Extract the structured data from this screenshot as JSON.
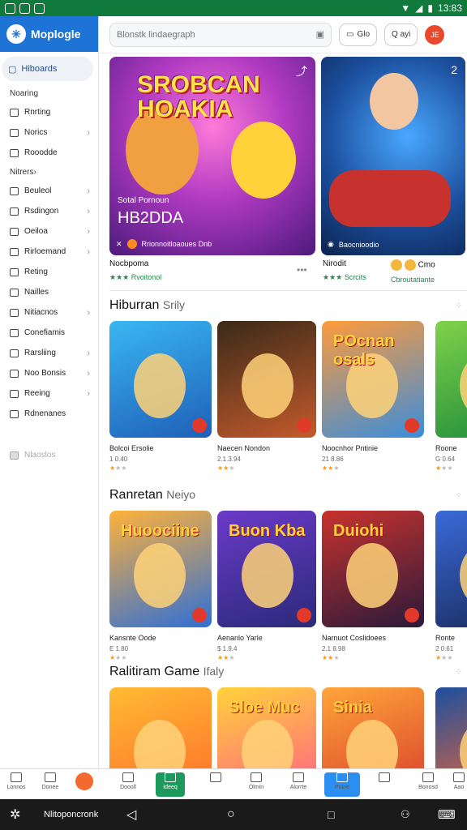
{
  "status_bar": {
    "time": "13:83"
  },
  "sidebar": {
    "brand": "Moplogle",
    "active_item": "Hiboards",
    "section_header": "Noaring",
    "items": [
      {
        "label": "Rnrting",
        "chev": false
      },
      {
        "label": "Norics",
        "chev": true
      },
      {
        "label": "Rooodde",
        "chev": false
      },
      {
        "label": "Nitrers",
        "chev": true,
        "header": true
      },
      {
        "label": "Beuleol",
        "chev": true
      },
      {
        "label": "Rsdingon",
        "chev": true
      },
      {
        "label": "Oeiloa",
        "chev": true
      },
      {
        "label": "Rirloemand",
        "chev": true
      },
      {
        "label": "Reting",
        "chev": false
      },
      {
        "label": "Nailles",
        "chev": false
      },
      {
        "label": "Nitiacnos",
        "chev": true
      },
      {
        "label": "Conefiamis",
        "chev": false
      },
      {
        "label": "Rarsliing",
        "chev": true
      },
      {
        "label": "Noo Bonsis",
        "chev": true
      },
      {
        "label": "Reeing",
        "chev": true
      },
      {
        "label": "Rdnenanes",
        "chev": false
      }
    ],
    "muted_item": "Nlaoslos"
  },
  "topbar": {
    "search_placeholder": "Blonstk lindaegraph",
    "btn1": "Glo",
    "btn2": "Q ayi",
    "avatar": "JE"
  },
  "hero": [
    {
      "title_line1": "SROBCAN",
      "title_line2": "HOAKIA",
      "subtitle": "Sotal Pornoun",
      "big": "HB2DDA",
      "footer": "Rrionnoitloaoues  Dnb",
      "name": "Nocbpoma",
      "rating": "★★★ Rvoitonol"
    },
    {
      "footer": "Baocnioodio",
      "name": "Nirodit",
      "side_text": "Cmo",
      "rating": "★★★ Scrcits",
      "side_rating": "Cbroutatiante",
      "badge": "2"
    }
  ],
  "sections": [
    {
      "title": "Hiburran",
      "title_thin": "Srily",
      "cards": [
        {
          "name": "Bolcoi Ersolie",
          "num": "1 0.40",
          "stars": 1,
          "thumb_title": ""
        },
        {
          "name": "Naecen Nondon",
          "num": "2.1.3.94",
          "stars": 2,
          "thumb_title": ""
        },
        {
          "name": "Noocnhor Pntinie",
          "num": "21 8.86",
          "stars": 2,
          "thumb_title": "POcnan osals"
        },
        {
          "name": "Roone",
          "num": "G 0.64",
          "stars": 1,
          "thumb_title": ""
        }
      ]
    },
    {
      "title": "Ranretan",
      "title_thin": "Neiyo",
      "cards": [
        {
          "name": "Kansnte Oode",
          "num": "E 1.80",
          "stars": 1,
          "thumb_title": "Huoociine"
        },
        {
          "name": "Aenanlo Yarle",
          "num": "$ 1.9.4",
          "stars": 2,
          "thumb_title": "Buon Kba"
        },
        {
          "name": "Narnuot Coslidoees",
          "num": "2.1 8.98",
          "stars": 2,
          "thumb_title": "Duiohi"
        },
        {
          "name": "Ronte",
          "num": "2 0.61",
          "stars": 1,
          "thumb_title": ""
        }
      ]
    },
    {
      "title": "Ralitiram Game",
      "title_thin": "Ifaly",
      "cards": [
        {
          "name": "",
          "num": "",
          "stars": 0,
          "thumb_title": ""
        },
        {
          "name": "",
          "num": "",
          "stars": 0,
          "thumb_title": "Sloe Muc"
        },
        {
          "name": "",
          "num": "",
          "stars": 0,
          "thumb_title": "Sinia"
        },
        {
          "name": "",
          "num": "",
          "stars": 0,
          "thumb_title": ""
        }
      ]
    }
  ],
  "bottom_nav": [
    "Lonnos",
    "Donee",
    "",
    "Doooll",
    "Ideeq",
    "",
    "Olmin",
    "Alorrte",
    "Poine",
    "",
    "Bonosd",
    "Aao"
  ],
  "system_bar": {
    "label": "Nlitoponcronk"
  }
}
